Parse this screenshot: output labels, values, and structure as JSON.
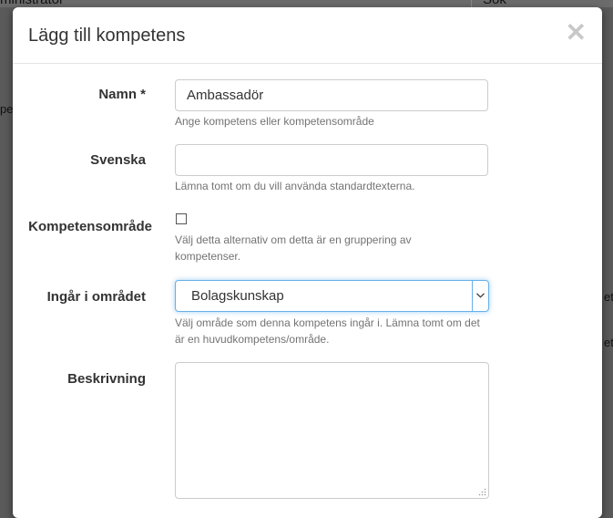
{
  "background": {
    "left_text": "ministratör",
    "right_text": "Sök",
    "edge_text_1": "pe",
    "edge_text_2": "ete",
    "edge_text_3": "ete"
  },
  "modal": {
    "title": "Lägg till kompetens",
    "close_icon": "close-icon"
  },
  "form": {
    "name": {
      "label": "Namn *",
      "value": "Ambassadör",
      "help": "Ange kompetens eller kompetensområde"
    },
    "swedish": {
      "label": "Svenska",
      "value": "",
      "help": "Lämna tomt om du vill använda standardtexterna."
    },
    "area": {
      "label": "Kompetensområde",
      "checked": false,
      "help": "Välj detta alternativ om detta är en gruppering av kompetenser."
    },
    "parent_area": {
      "label": "Ingår i området",
      "selected": "Bolagskunskap",
      "help": "Välj område som denna kompetens ingår i. Lämna tomt om det är en huvudkompetens/område."
    },
    "description": {
      "label": "Beskrivning",
      "value": ""
    }
  },
  "colors": {
    "focus_border": "#66afe9",
    "help_text": "#737373",
    "label_text": "#333333"
  }
}
